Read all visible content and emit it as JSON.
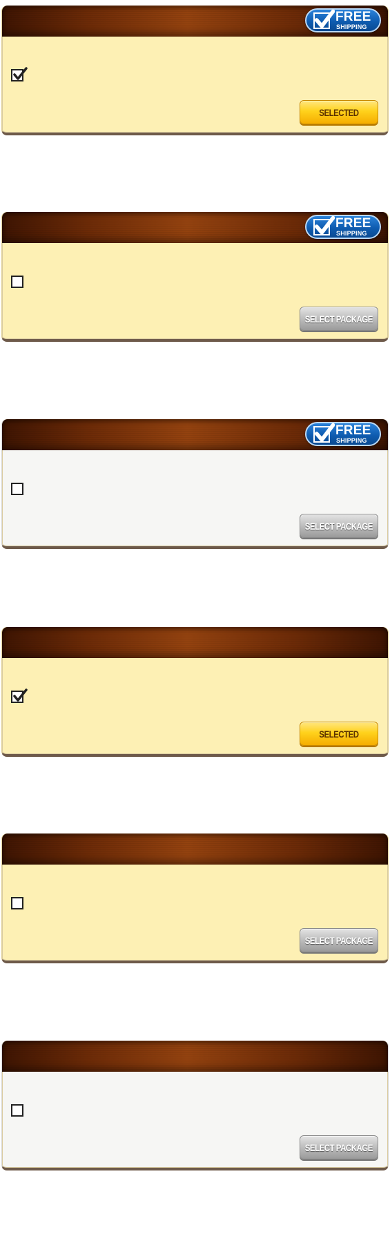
{
  "packages": [
    {
      "checked": true,
      "badge": {
        "title": "FREE",
        "subtitle": "SHIPPING"
      },
      "button_label": "SELECTED",
      "button_state": "selected",
      "body_color": "#fdf0b4"
    },
    {
      "checked": false,
      "badge": {
        "title": "FREE",
        "subtitle": "SHIPPING"
      },
      "button_label": "SELECT PACKAGE",
      "button_state": "unselected",
      "body_color": "#fdf0b4"
    },
    {
      "checked": false,
      "badge": {
        "title": "FREE",
        "subtitle": "SHIPPING"
      },
      "button_label": "SELECT PACKAGE",
      "button_state": "unselected",
      "body_color": "#f6f6f4"
    },
    {
      "checked": true,
      "badge": null,
      "button_label": "SELECTED",
      "button_state": "selected",
      "body_color": "#fdf0b4"
    },
    {
      "checked": false,
      "badge": null,
      "button_label": "SELECT PACKAGE",
      "button_state": "unselected",
      "body_color": "#fdf0b4"
    },
    {
      "checked": false,
      "badge": null,
      "button_label": "SELECT PACKAGE",
      "button_state": "unselected",
      "body_color": "#f6f6f4"
    }
  ],
  "colors": {
    "header_dark": "#3d1402",
    "header_mid": "#93420f",
    "selected_button": "#ffd21c",
    "unselected_button": "#bdbdbd",
    "badge_blue": "#0f5cb0"
  },
  "icons": {
    "checkbox_checked": "checkmark-icon",
    "badge_check": "checkmark-icon"
  }
}
